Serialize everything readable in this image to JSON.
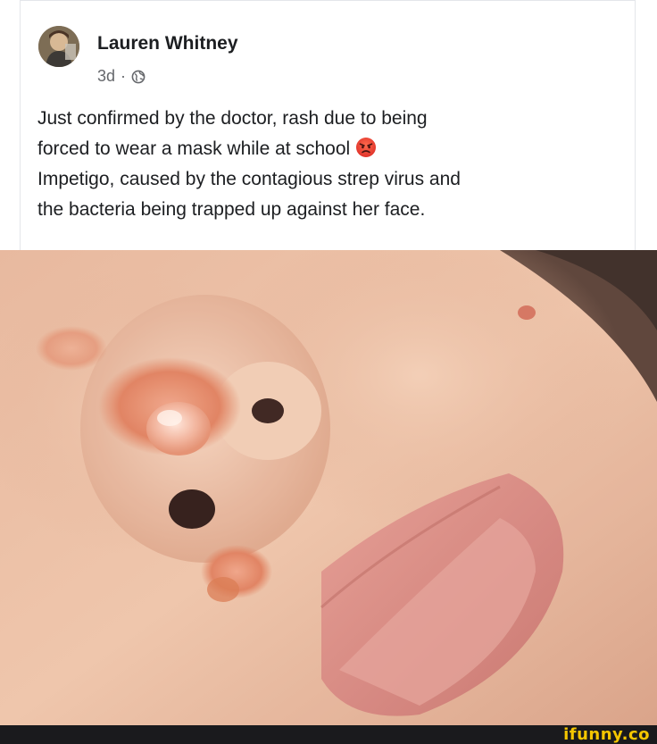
{
  "post": {
    "author": "Lauren Whitney",
    "timestamp": "3d",
    "separator": "·",
    "privacy_icon": "globe-icon",
    "text_lines": [
      "Just confirmed by the doctor, rash due to being",
      "forced to wear a mask while at school",
      "Impetigo, caused by the contagious strep virus and",
      "the bacteria being trapped up against her face."
    ],
    "inline_emoji": "angry-face-emoji"
  },
  "photo": {
    "subject": "close-up-face-rash-photo"
  },
  "watermark": {
    "text": "ifunny.co",
    "color": "#f5c600"
  },
  "colors": {
    "text_primary": "#1c1e21",
    "text_secondary": "#65676b",
    "footer_bar": "#1a1a1d"
  }
}
